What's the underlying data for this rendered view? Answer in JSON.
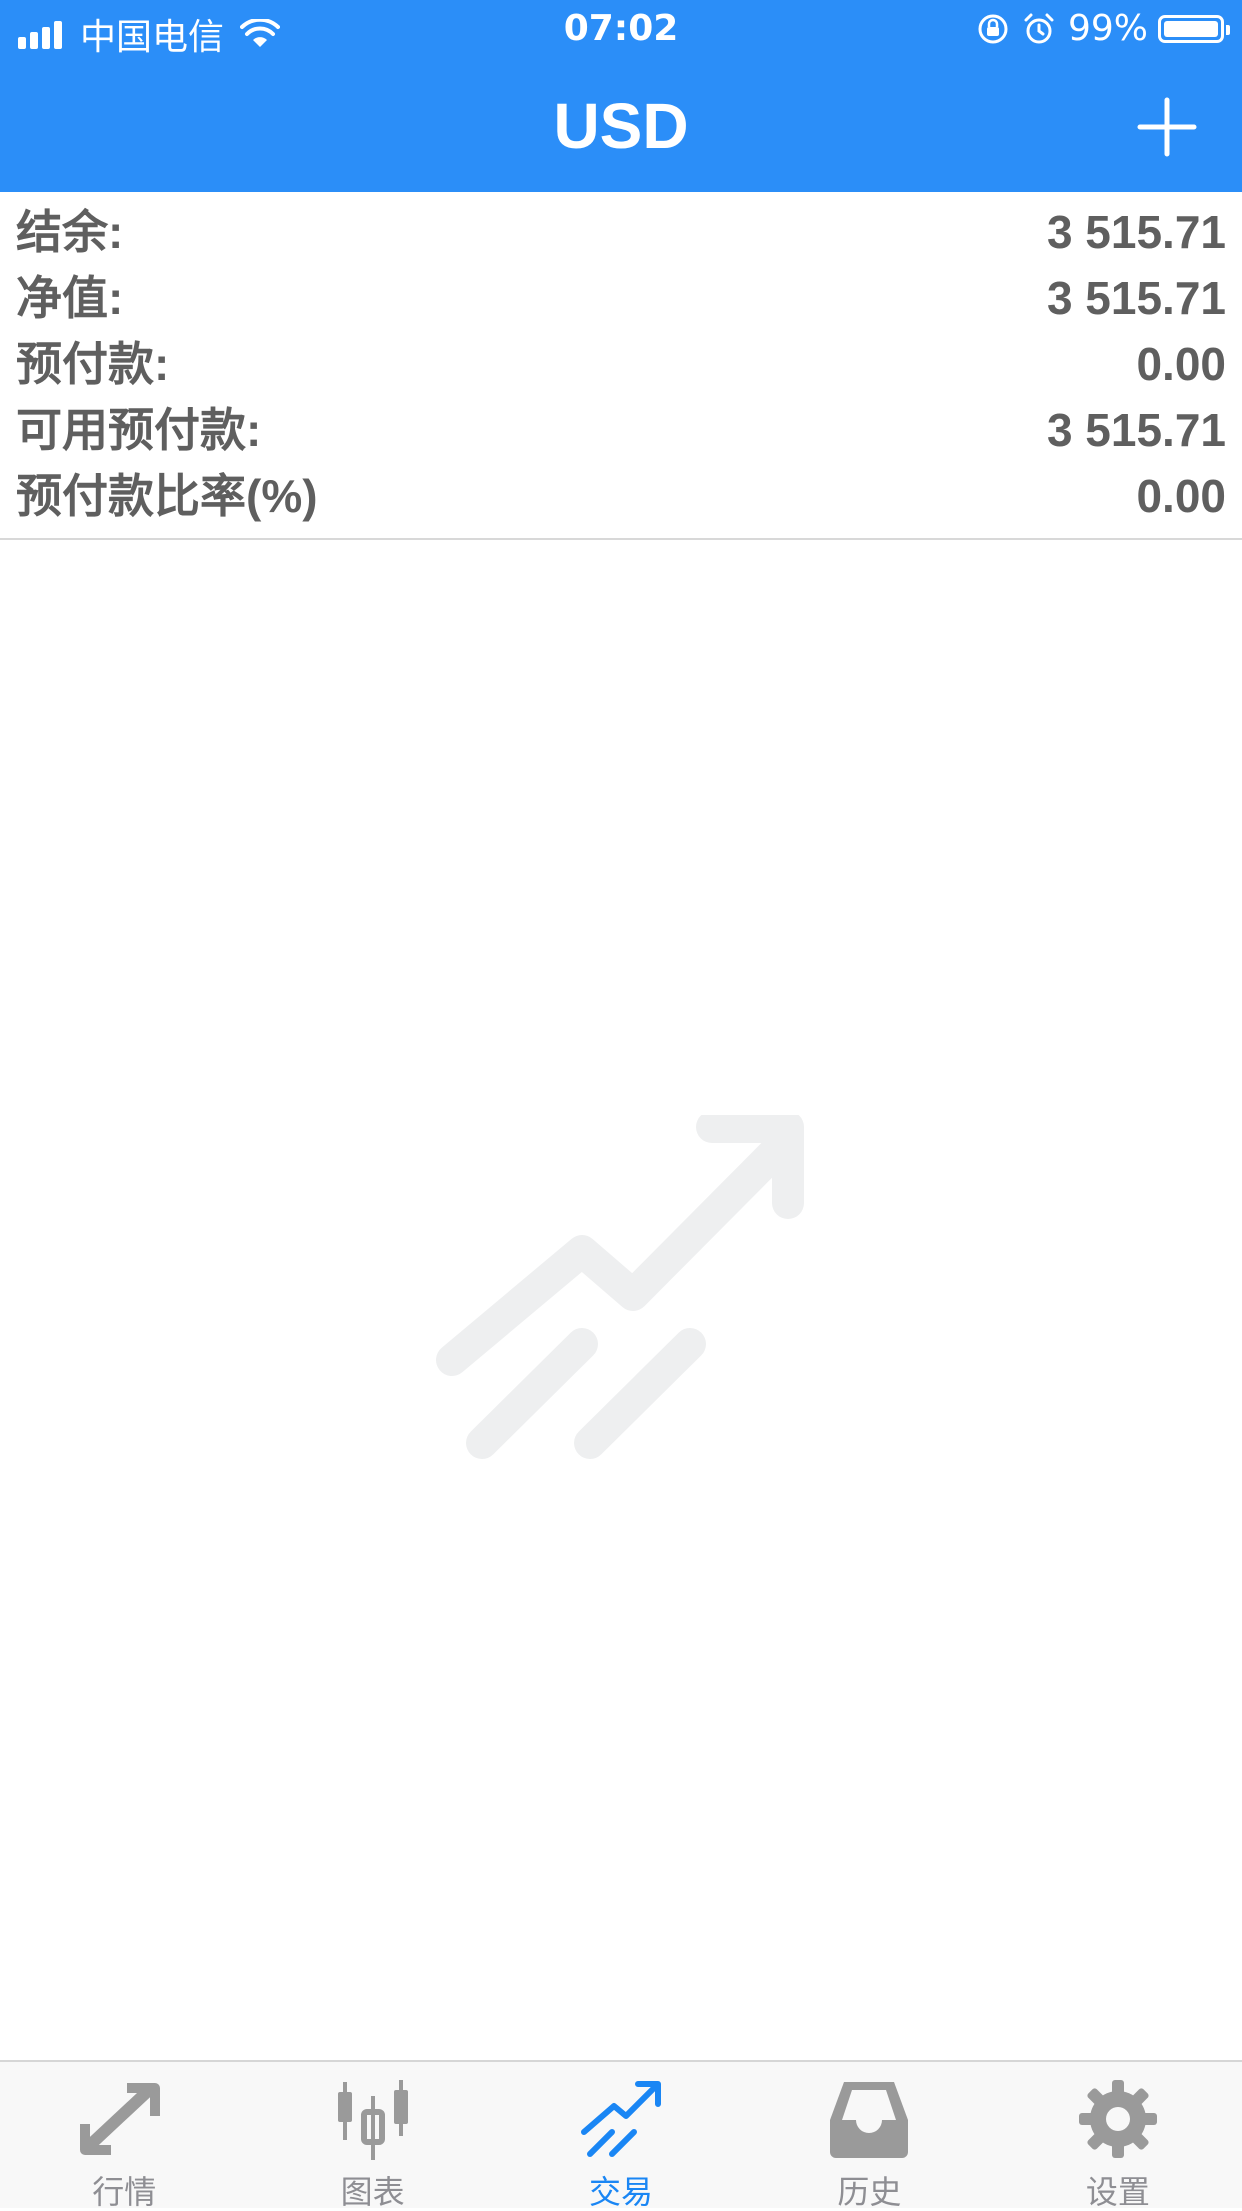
{
  "status_bar": {
    "carrier": "中国电信",
    "time": "07:02",
    "battery": "99%",
    "battery_level": 0.99
  },
  "header": {
    "title": "USD",
    "add_icon": "plus-icon"
  },
  "summary": [
    {
      "label": "结余:",
      "value": "3 515.71"
    },
    {
      "label": "净值:",
      "value": "3 515.71"
    },
    {
      "label": "预付款:",
      "value": "0.00"
    },
    {
      "label": "可用预付款:",
      "value": "3 515.71"
    },
    {
      "label": "预付款比率(%)",
      "value": "0.00"
    }
  ],
  "empty_state": {
    "icon": "trade-trend-icon"
  },
  "tabs": [
    {
      "label": "行情",
      "icon": "quotes-icon",
      "active": false
    },
    {
      "label": "图表",
      "icon": "chart-candles-icon",
      "active": false
    },
    {
      "label": "交易",
      "icon": "trade-icon",
      "active": true
    },
    {
      "label": "历史",
      "icon": "history-inbox-icon",
      "active": false
    },
    {
      "label": "设置",
      "icon": "settings-gear-icon",
      "active": false
    }
  ],
  "colors": {
    "header_blue": "#2b8ef8",
    "active_tab": "#1a86f4",
    "inactive_tab": "#8e8e93",
    "text": "#5f5f5f"
  }
}
